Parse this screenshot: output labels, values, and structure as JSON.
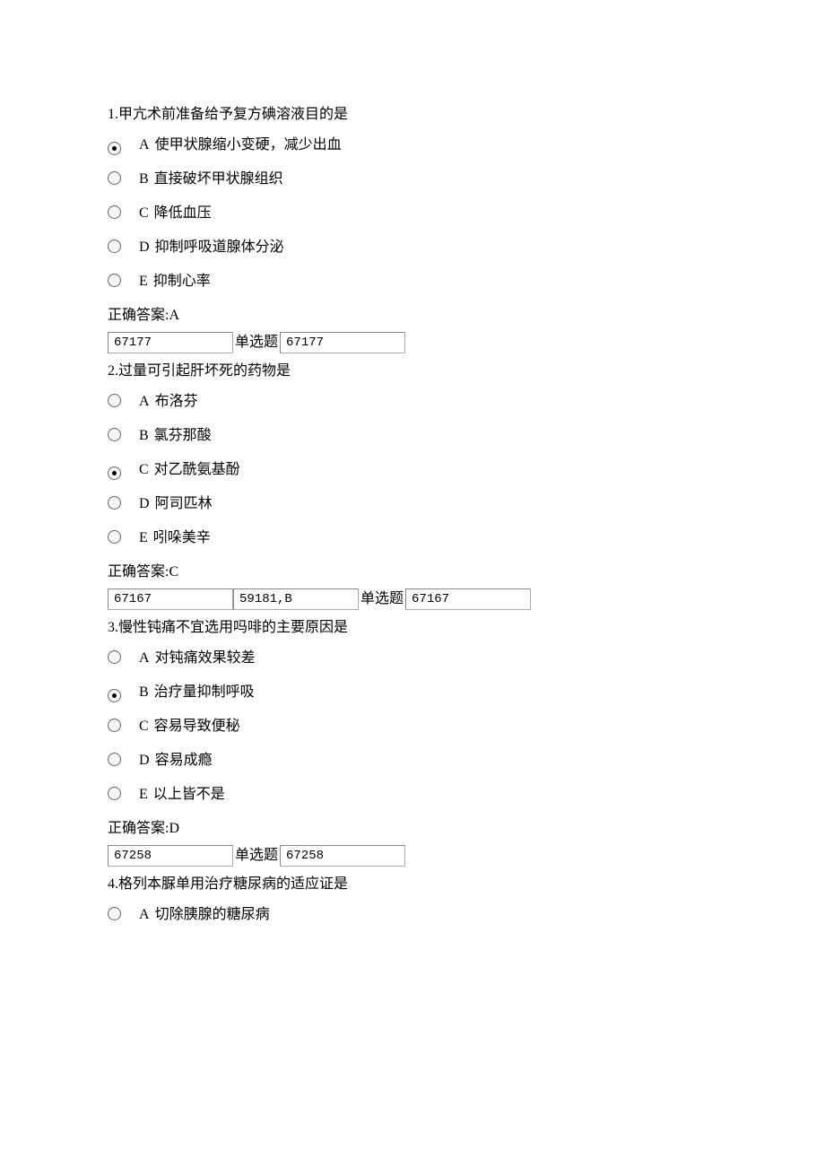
{
  "label_single_choice": "单选题",
  "answer_prefix": "正确答案:",
  "questions": [
    {
      "text": "1.甲亢术前准备给予复方碘溶液目的是",
      "options": [
        {
          "letter": "A",
          "text": "使甲状腺缩小变硬，减少出血",
          "selected": true
        },
        {
          "letter": "B",
          "text": "直接破坏甲状腺组织",
          "selected": false
        },
        {
          "letter": "C",
          "text": "降低血压",
          "selected": false
        },
        {
          "letter": "D",
          "text": "抑制呼吸道腺体分泌",
          "selected": false
        },
        {
          "letter": "E",
          "text": "抑制心率",
          "selected": false
        }
      ],
      "answer": "A",
      "inputs": [
        "67177",
        "67177"
      ],
      "extra_input": null
    },
    {
      "text": "2.过量可引起肝坏死的药物是",
      "options": [
        {
          "letter": "A",
          "text": "布洛芬",
          "selected": false
        },
        {
          "letter": "B",
          "text": "氯芬那酸",
          "selected": false
        },
        {
          "letter": "C",
          "text": "对乙酰氨基酚",
          "selected": true
        },
        {
          "letter": "D",
          "text": "阿司匹林",
          "selected": false
        },
        {
          "letter": "E",
          "text": "吲哚美辛",
          "selected": false
        }
      ],
      "answer": "C",
      "inputs": [
        "67167",
        "67167"
      ],
      "extra_input": "59181,B"
    },
    {
      "text": "3.慢性钝痛不宜选用吗啡的主要原因是",
      "options": [
        {
          "letter": "A",
          "text": "对钝痛效果较差",
          "selected": false
        },
        {
          "letter": "B",
          "text": "治疗量抑制呼吸",
          "selected": true
        },
        {
          "letter": "C",
          "text": "容易导致便秘",
          "selected": false
        },
        {
          "letter": "D",
          "text": "容易成瘾",
          "selected": false
        },
        {
          "letter": "E",
          "text": "以上皆不是",
          "selected": false
        }
      ],
      "answer": "D",
      "inputs": [
        "67258",
        "67258"
      ],
      "extra_input": null
    },
    {
      "text": "4.格列本脲单用治疗糖尿病的适应证是",
      "options": [
        {
          "letter": "A",
          "text": "切除胰腺的糖尿病",
          "selected": false
        }
      ],
      "answer": null,
      "inputs": null,
      "extra_input": null
    }
  ]
}
